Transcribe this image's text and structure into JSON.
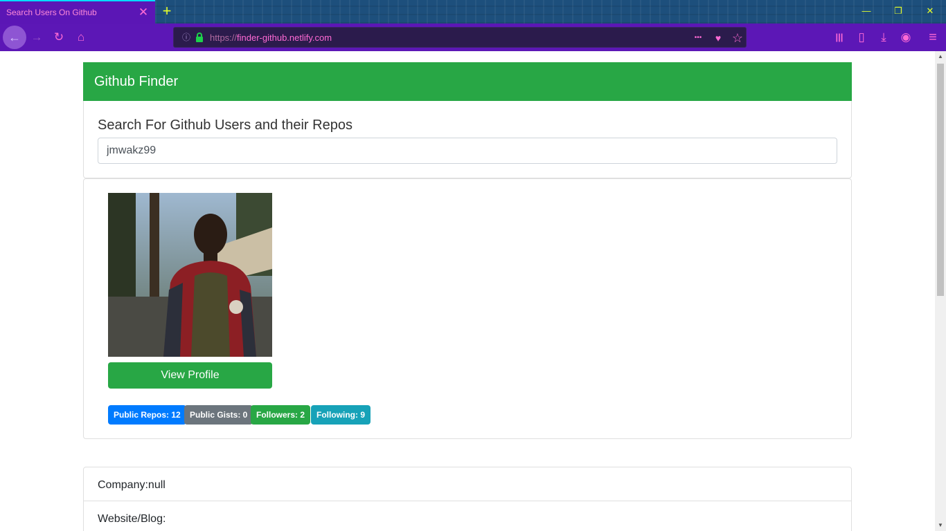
{
  "browser": {
    "tab_title": "Search Users On Github",
    "tab_close": "✕",
    "new_tab": "+",
    "url_protocol": "https://",
    "url_host": "finder-github.netlify.com",
    "icons": {
      "back": "←",
      "forward": "→",
      "reload": "↻",
      "home": "⌂",
      "info": "ⓘ",
      "more": "•••",
      "pocket": "♥",
      "bookmark": "☆",
      "library": "|||",
      "sidebar": "▯",
      "download": "⤓",
      "account": "◉",
      "menu": "≡",
      "minimize": "—",
      "restore": "❐",
      "close": "✕"
    }
  },
  "header": {
    "title": "Github Finder"
  },
  "search": {
    "heading": "Search For Github Users and their Repos",
    "value": "jmwakz99"
  },
  "profile": {
    "view_button": "View Profile",
    "badges": [
      {
        "label": "Public Repos: 12",
        "color": "#007bff"
      },
      {
        "label": "Public Gists: 0",
        "color": "#6c757d"
      },
      {
        "label": "Followers: 2",
        "color": "#28a745"
      },
      {
        "label": "Following: 9",
        "color": "#17a2b8"
      }
    ]
  },
  "info": {
    "company": "Company:null",
    "website": "Website/Blog:"
  },
  "colors": {
    "accent_green": "#28a745",
    "browser_purple": "#5c17b6",
    "browser_pink": "#ff6ad5"
  }
}
